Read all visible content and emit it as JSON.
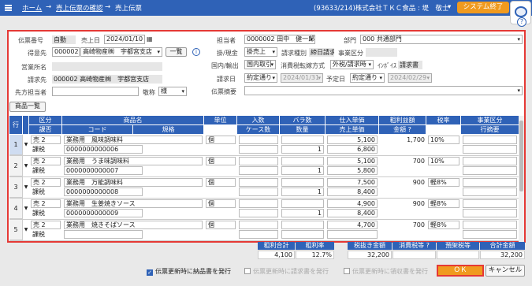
{
  "topbar": {
    "home": "ホーム",
    "sep1": "→",
    "confirm": "売上伝票の確認",
    "sep2": "→",
    "current": "売上伝票",
    "company": "(93633/214)株式会社ＴＫＣ食品 : 堤　敬士",
    "user_arrow": "▾",
    "end_button": "システム終了"
  },
  "help": "?",
  "header": {
    "slip_no_label": "伝票番号",
    "slip_no_value": "自動",
    "sales_date_label": "売上日",
    "sales_date_value": "2024/01/10",
    "customer_label": "得意先",
    "customer_code": "000002",
    "customer_name": "高崎物産㈱　宇都宮支店",
    "list_button": "一覧",
    "info": "i",
    "office_label": "営業所名",
    "billing_label": "請求先",
    "billing_value": "000002 高崎物産㈱　宇都宮支店",
    "contact_label": "先方担当者",
    "honorific_label": "敬称",
    "honorific_value": "様",
    "staff_label": "担当者",
    "staff_value": "0000002 田中　健一郎",
    "dept_label": "部門",
    "dept_value": "000 共通部門",
    "pay_label": "掛/現金",
    "pay_value": "掛売上",
    "bill_type_label": "請求種別",
    "bill_type_value": "締日請求",
    "business_label": "事業区分",
    "domestic_label": "国内/輸出",
    "domestic_value": "国内取引",
    "tax_method_label": "消費税転嫁方式",
    "tax_method_value": "外税/請求時",
    "invoice_label": "ｲﾝﾎﾞｲｽ",
    "invoice_value": "請求書",
    "bill_date_label": "請求日",
    "bill_date_mode": "約定通り",
    "bill_date_value": "2024/01/31",
    "due_label": "予定日",
    "due_mode": "約定通り",
    "due_value": "2024/02/29",
    "summary_label": "伝票摘要"
  },
  "product_list_button": "商品一覧",
  "table": {
    "headers_top": [
      "行",
      "区分",
      "商品名",
      "単位",
      "入数",
      "バラ数",
      "仕入単価",
      "粗利益額",
      "税率",
      "事業区分"
    ],
    "headers_bottom": [
      "課否",
      "コード",
      "規格",
      "ケース数",
      "数量",
      "売上単価",
      "金額 ?",
      "行摘要"
    ],
    "rows": [
      {
        "no": "1",
        "kubun": "売 2",
        "kahi": "課税",
        "name": "業務用　風味調味料",
        "code": "0000000000006",
        "unit": "個",
        "qty": "1",
        "cost": "5,100",
        "price": "6,800",
        "profit": "1,700",
        "tax": "10%"
      },
      {
        "no": "2",
        "kubun": "売 2",
        "kahi": "課税",
        "name": "業務用　うま味調味料",
        "code": "0000000000007",
        "unit": "個",
        "qty": "1",
        "cost": "5,100",
        "price": "5,800",
        "profit": "700",
        "tax": "10%"
      },
      {
        "no": "3",
        "kubun": "売 2",
        "kahi": "課税",
        "name": "業務用　万能調味料",
        "code": "0000000000008",
        "unit": "個",
        "qty": "1",
        "cost": "7,500",
        "price": "8,400",
        "profit": "900",
        "tax": "軽8%"
      },
      {
        "no": "4",
        "kubun": "売 2",
        "kahi": "課税",
        "name": "業務用　生姜焼きソース",
        "code": "0000000000009",
        "unit": "個",
        "qty": "1",
        "cost": "4,900",
        "price": "8,400",
        "profit": "900",
        "tax": "軽8%"
      },
      {
        "no": "5",
        "kubun": "売 2",
        "kahi": "課税",
        "name": "業務用　焼きそばソース",
        "code": "",
        "unit": "個",
        "qty": "",
        "cost": "4,700",
        "price": "",
        "profit": "700",
        "tax": "軽8%"
      }
    ]
  },
  "summary": {
    "gross_label": "粗利合計",
    "gross_value": "4,100",
    "rate_label": "粗利率",
    "rate_value": "12.7%",
    "pretax_label": "税抜き金額",
    "pretax_value": "32,200",
    "tax_label": "消費税等",
    "tax_value": "",
    "stamp_label": "預架税等",
    "stamp_value": "",
    "total_label": "合計金額",
    "total_value": "32,200"
  },
  "footer": {
    "opt1": "伝票更新時に納品書を発行",
    "opt2": "伝票更新時に請求書を発行",
    "opt3": "伝票更新時に領収書を発行",
    "ok": "ＯＫ",
    "cancel": "キャンセル"
  }
}
